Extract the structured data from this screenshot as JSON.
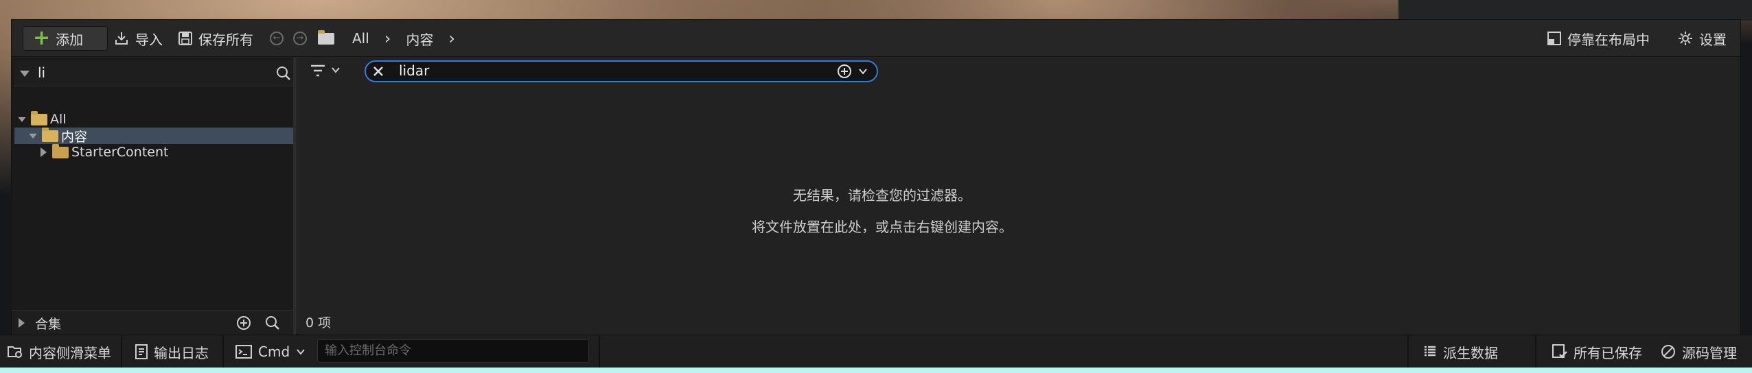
{
  "toolbar": {
    "add_label": "添加",
    "import_label": "导入",
    "save_all_label": "保存所有",
    "breadcrumb": [
      "All",
      "内容"
    ],
    "dock_label": "停靠在布局中",
    "settings_label": "设置"
  },
  "left_panel": {
    "search_value": "li",
    "tree": [
      {
        "label": "All",
        "expanded": true
      },
      {
        "label": "内容",
        "expanded": true,
        "selected": true
      },
      {
        "label": "StarterContent",
        "expanded": false
      }
    ],
    "collections_label": "合集"
  },
  "main": {
    "search_value": "lidar",
    "empty_message_1": "无结果，请检查您的过滤器。",
    "empty_message_2": "将文件放置在此处，或点击右键创建内容。",
    "item_count": "0 项"
  },
  "statusbar": {
    "content_drawer": "内容侧滑菜单",
    "output_log": "输出日志",
    "cmd_label": "Cmd",
    "console_placeholder": "输入控制台命令",
    "derived_data": "派生数据",
    "all_saved": "所有已保存",
    "source_control": "源码管理"
  },
  "colors": {
    "accent_blue": "#2f7fd6",
    "add_green": "#7cc242",
    "selection": "#3f4c5c",
    "folder": "#c9a04e"
  }
}
